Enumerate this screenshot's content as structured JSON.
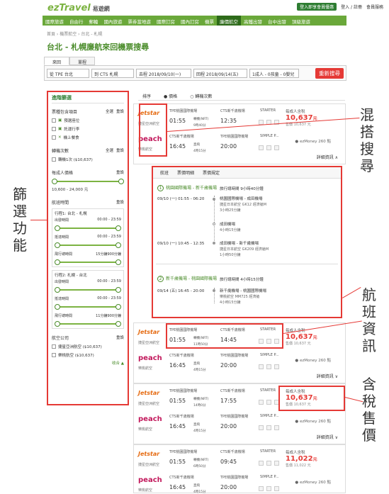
{
  "header": {
    "logo": "ezTravel",
    "logo_sub": "易遊網",
    "member_btn": "登入即享會員優惠",
    "login": "登入 / 註冊",
    "member_service": "會員服務"
  },
  "nav": [
    "國際旅遊",
    "自由行",
    "郵輪",
    "國內旅遊",
    "票券當地遊",
    "國際訂房",
    "國內訂房",
    "機票",
    "廉價航空",
    "高鐵出發",
    "台中出發",
    "頂級旅遊"
  ],
  "breadcrumb": "首頁 › 機票航空 › 台北 - 札幌",
  "page_title": "台北 - 札幌廉航來回機票搜尋",
  "trip_tabs": [
    "來回",
    "單程"
  ],
  "search": {
    "from": "從 TPE 台北",
    "to": "到 CTS 札幌",
    "depart": "去程 2018/09/10(一)",
    "return": "回程 2018/09/14(五)",
    "pax": "1成人 - 0孩童 - 0嬰兒",
    "button": "重新搜尋"
  },
  "filters": {
    "title": "進階篩選",
    "group1": {
      "title": "票種包含項目",
      "all": "全選",
      "clear": "重設",
      "items": [
        "預選座位",
        "託運行李",
        "機上餐食"
      ]
    },
    "group2": {
      "title": "轉機次數",
      "all": "全選",
      "clear": "重設",
      "items": [
        "轉機1次 ($10,637)"
      ]
    },
    "group3": {
      "title": "每成人價格",
      "clear": "重設",
      "range": "10,600 - 24,000 元"
    },
    "group4": {
      "title": "航班時間",
      "clear": "重設",
      "leg1": {
        "title": "行程1: 台北 - 札幌",
        "rows": [
          {
            "l": "出發時間",
            "r": "00:00 - 23:59"
          },
          {
            "l": "抵達時間",
            "r": "00:00 - 23:59"
          },
          {
            "l": "飛行總時間",
            "r": "15分鐘900分鐘"
          }
        ]
      },
      "leg2": {
        "title": "行程2: 札幌 - 台北",
        "rows": [
          {
            "l": "出發時間",
            "r": "00:00 - 23:59"
          },
          {
            "l": "抵達時間",
            "r": "00:00 - 23:59"
          },
          {
            "l": "飛行總時間",
            "r": "11分鐘900分鐘"
          }
        ]
      }
    },
    "group5": {
      "title": "航空公司",
      "clear": "重設",
      "items": [
        "捷星亞洲航空 ($10,637)",
        "樂桃航空 ($10,637)"
      ],
      "more": "收合"
    }
  },
  "sort": [
    "排序",
    "價格",
    "轉機次數"
  ],
  "results": [
    {
      "leg1": {
        "logo": "Jetstar",
        "name": "捷星亞洲航空",
        "from_apt": "TPE桃園國際機場",
        "to_apt": "CTS新千歲機場",
        "dep": "01:55",
        "arr": "12:35",
        "via": "轉機(NRT)",
        "dur": "9時40分",
        "cls": "STARTER"
      },
      "leg2": {
        "logo": "peach",
        "name": "樂桃航空",
        "from_apt": "CTS新千歲機場",
        "to_apt": "TPE桃園國際機場",
        "dep": "16:45",
        "arr": "20:00",
        "via": "直飛",
        "dur": "4時15分",
        "cls": "SIMPLE P..."
      },
      "price_label": "每成人含稅",
      "price": "10,637",
      "price_unit": "元",
      "price_sub": "售價 10,637 元",
      "emoney": "ezMoney 260 點",
      "detail": "詳細資訊 ∧"
    },
    {
      "leg1": {
        "logo": "Jetstar",
        "name": "捷星亞洲航空",
        "from_apt": "TPE桃園國際機場",
        "to_apt": "CTS新千歲機場",
        "dep": "01:55",
        "arr": "14:45",
        "via": "轉機(NRT)",
        "dur": "11時50分",
        "cls": "STARTER"
      },
      "leg2": {
        "logo": "peach",
        "name": "樂桃航空",
        "from_apt": "CTS新千歲機場",
        "to_apt": "TPE桃園國際機場",
        "dep": "16:45",
        "arr": "20:00",
        "via": "直飛",
        "dur": "4時15分",
        "cls": "SIMPLE P..."
      },
      "price_label": "每成人含稅",
      "price": "10,637",
      "price_unit": "元",
      "price_sub": "售價 10,637 元",
      "emoney": "ezMoney 260 點",
      "detail": "詳細資訊 ∨"
    },
    {
      "leg1": {
        "logo": "Jetstar",
        "name": "捷星亞洲航空",
        "from_apt": "TPE桃園國際機場",
        "to_apt": "CTS新千歲機場",
        "dep": "01:55",
        "arr": "17:55",
        "via": "轉機(NRT)",
        "dur": "14時0分",
        "cls": "STARTER"
      },
      "leg2": {
        "logo": "peach",
        "name": "樂桃航空",
        "from_apt": "CTS新千歲機場",
        "to_apt": "TPE桃園國際機場",
        "dep": "16:45",
        "arr": "20:00",
        "via": "直飛",
        "dur": "4時15分",
        "cls": "SIMPLE P..."
      },
      "price_label": "每成人含稅",
      "price": "10,637",
      "price_unit": "元",
      "price_sub": "售價 10,637 元",
      "emoney": "ezMoney 260 點",
      "detail": "詳細資訊 ∨"
    },
    {
      "leg1": {
        "logo": "Jetstar",
        "name": "捷星亞洲航空",
        "from_apt": "TPE桃園國際機場",
        "to_apt": "CTS新千歲機場",
        "dep": "01:55",
        "arr": "09:45",
        "via": "轉機(NRT)",
        "dur": "6時50分",
        "cls": "STARTER"
      },
      "leg2": {
        "logo": "peach",
        "name": "樂桃航空",
        "from_apt": "CTS新千歲機場",
        "to_apt": "TPE桃園國際機場",
        "dep": "16:45",
        "arr": "20:00",
        "via": "直飛",
        "dur": "4時15分",
        "cls": "SIMPLE P..."
      },
      "price_label": "每成人含稅",
      "price": "11,022",
      "price_unit": "元",
      "price_sub": "售價 11,022 元",
      "emoney": "ezMoney 260 點",
      "detail": ""
    }
  ],
  "detail": {
    "tabs": [
      "航班",
      "票價明細",
      "票價規定"
    ],
    "seg1": {
      "num": "1",
      "title": "桃園國際機場 - 新千歲機場",
      "total": "旅行總時間 9小時40分鐘"
    },
    "seg1_rows": [
      {
        "time": "09/10 (一) 01:55 - 06:20",
        "info": "桃園國際機場 - 成田機場",
        "sub1": "捷星日本航空 GK12 經濟艙M",
        "sub2": "3小時25分鐘"
      },
      {
        "info": "成田機場",
        "sub1": "4小時15分鐘"
      },
      {
        "time": "09/10 (一) 10:45 - 12:35",
        "info": "成田機場 - 新千歲機場",
        "sub1": "捷星日本航空 GK209 經濟艙M",
        "sub2": "1小時50分鐘"
      }
    ],
    "seg2": {
      "num": "2",
      "title": "新千歲機場 - 桃園國際機場",
      "total": "旅行總時間 4小時15分鐘"
    },
    "seg2_row": {
      "time": "09/14 (五) 16:45 - 20:00",
      "info": "新千歲機場 - 桃園國際機場",
      "sub1": "樂桃航空 MM725 經濟艙",
      "sub2": "4小時15分鐘"
    }
  },
  "callouts": {
    "mix": "混搭搜尋",
    "filter": "篩選功能",
    "info": "航班資訊",
    "tax": "含稅售價"
  },
  "colors": {
    "accent": "#6aa83a",
    "highlight": "#e53935",
    "price": "#e53935"
  }
}
